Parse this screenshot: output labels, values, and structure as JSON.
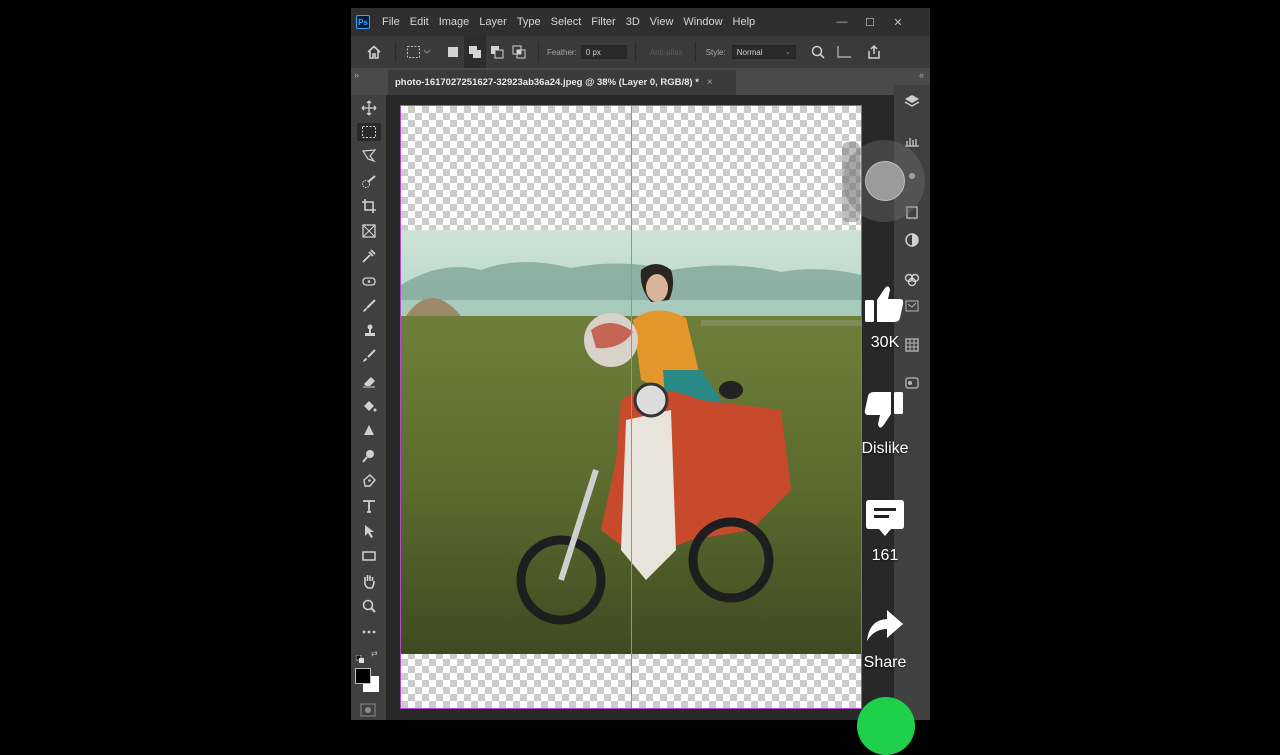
{
  "app": {
    "logo_text": "Ps",
    "menus": [
      "File",
      "Edit",
      "Image",
      "Layer",
      "Type",
      "Select",
      "Filter",
      "3D",
      "View",
      "Window",
      "Help"
    ],
    "window_controls": {
      "minimize": "—",
      "maximize": "☐",
      "close": "✕"
    }
  },
  "options_bar": {
    "feather_label": "Feather:",
    "feather_value": "0 px",
    "anti_alias_label": "Anti-alias",
    "style_label": "Style:",
    "style_value": "Normal"
  },
  "document": {
    "tab_title": "photo-1617027251627-32923ab36a24.jpeg @ 38% (Layer 0, RGB/8) *",
    "close": "×"
  },
  "panels": {
    "collapse_left": "»",
    "collapse_right": "«"
  },
  "overlay": {
    "like_count": "30K",
    "dislike_label": "Dislike",
    "comment_count": "161",
    "share_label": "Share",
    "text_color": "#ffffff",
    "accent_green": "#1fd14a"
  },
  "icons": {
    "toolbar": [
      "move-icon",
      "marquee-icon",
      "lasso-icon",
      "quick-select-icon",
      "crop-icon",
      "frame-icon",
      "eyedropper-icon",
      "spot-healing-icon",
      "brush-icon",
      "clone-stamp-icon",
      "history-brush-icon",
      "eraser-icon",
      "paint-bucket-icon",
      "blur-icon",
      "dodge-icon",
      "pen-icon",
      "type-icon",
      "path-selection-icon",
      "rectangle-icon",
      "hand-icon",
      "zoom-icon",
      "more-tools-icon"
    ],
    "right_panel": [
      "layers-icon",
      "histogram-icon",
      "adjustments-icon",
      "libraries-icon",
      "channels-icon",
      "paths-icon",
      "properties-icon",
      "styles-icon"
    ]
  }
}
